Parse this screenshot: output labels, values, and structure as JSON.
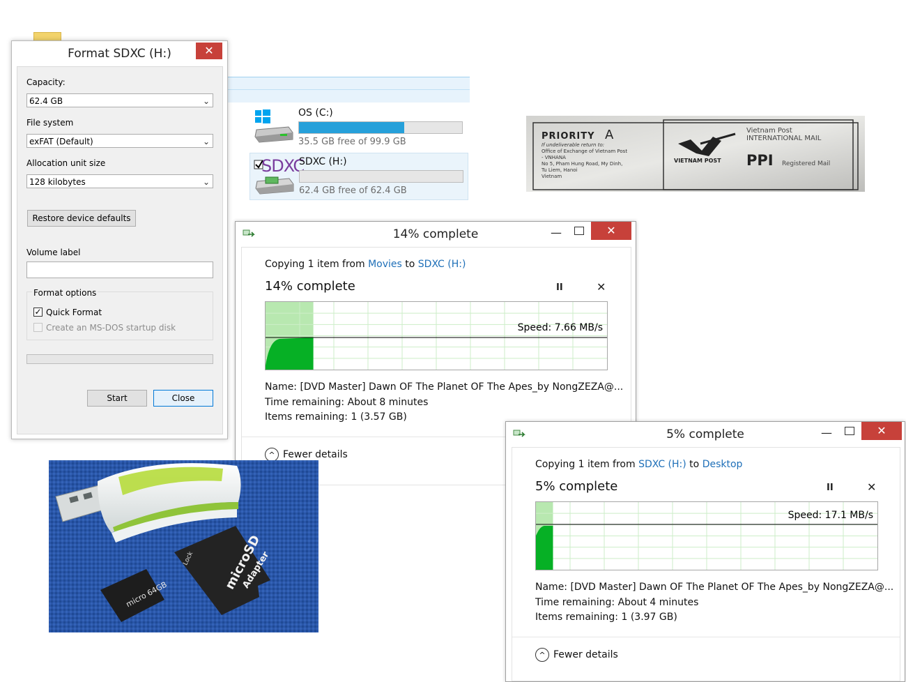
{
  "explorer": {
    "drives": [
      {
        "name": "OS (C:)",
        "free_text": "35.5 GB free of 99.9 GB",
        "used_fraction": 0.645
      },
      {
        "name": "SDXC (H:)",
        "free_text": "62.4 GB free of 62.4 GB",
        "used_fraction": 0.0,
        "overlay_text": "SDXC"
      }
    ]
  },
  "format_dialog": {
    "title": "Format SDXC (H:)",
    "close_glyph": "✕",
    "capacity_label": "Capacity:",
    "capacity_value": "62.4 GB",
    "file_system_label": "File system",
    "file_system_value": "exFAT (Default)",
    "allocation_label": "Allocation unit size",
    "allocation_value": "128 kilobytes",
    "restore_button": "Restore device defaults",
    "volume_label": "Volume label",
    "volume_value": "",
    "format_options_label": "Format options",
    "quick_format_label": "Quick Format",
    "quick_format_checked": true,
    "msdos_label": "Create an MS-DOS startup disk",
    "start_button": "Start",
    "close_button": "Close"
  },
  "copy_dialogs": [
    {
      "title": "14% complete",
      "from_prefix": "Copying 1 item from ",
      "source": "Movies",
      "to_word": " to ",
      "dest": "SDXC (H:)",
      "percent_text": "14% complete",
      "percent": 14,
      "speed": "Speed: 7.66 MB/s",
      "name_line": "Name:  [DVD Master] Dawn OF The Planet OF The Apes_by NongZEZA@...",
      "time_line": "Time remaining:  About 8 minutes",
      "items_line": "Items remaining:  1 (3.57 GB)",
      "fewer": "Fewer details"
    },
    {
      "title": "5% complete",
      "from_prefix": "Copying 1 item from ",
      "source": "SDXC (H:)",
      "to_word": " to ",
      "dest": "Desktop",
      "percent_text": "5% complete",
      "percent": 5,
      "speed": "Speed: 17.1 MB/s",
      "name_line": "Name:  [DVD Master] Dawn OF The Planet OF The Apes_by NongZEZA@...",
      "time_line": "Time remaining:  About 4 minutes",
      "items_line": "Items remaining:  1 (3.97 GB)",
      "fewer": "Fewer details"
    }
  ],
  "common": {
    "minimize": "—",
    "pause": "II",
    "cancel": "✕",
    "chevron": "⌄",
    "up_chevron": "^"
  },
  "photos": {
    "label": {
      "priority": "PRIORITY",
      "grade": "A",
      "undeliverable": "If undeliverable return to:",
      "return_lines": [
        "Office of Exchange of Vietnam Post",
        "- VNHANA",
        "No 5, Pham Hung Road, My Dinh,",
        "Tu Liem, Hanoi",
        "Vietnam"
      ],
      "vn_post": "Vietnam  Post",
      "intl_mail": "INTERNATIONAL MAIL",
      "brand": "VIETNAM POST",
      "ppi": "PPI",
      "registered": "Registered Mail"
    },
    "card": {
      "micro": "micro",
      "sd": "SD",
      "adapter": "Adapter",
      "lock": "Lock",
      "capacity": "64GB"
    }
  },
  "colors": {
    "accent_blue": "#26a0da",
    "close_red": "#c7413a",
    "graph_green": "#06b025",
    "graph_light": "#b8e8b0",
    "link_blue": "#1e6fb8"
  }
}
